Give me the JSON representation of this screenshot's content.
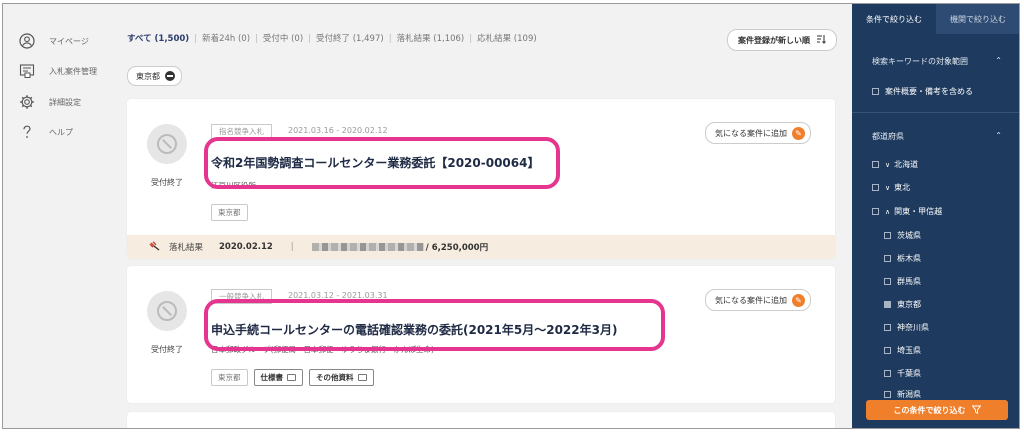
{
  "nav": {
    "items": [
      {
        "label": "マイページ",
        "icon": "user-circle-icon"
      },
      {
        "label": "入札案件管理",
        "icon": "document-list-icon"
      },
      {
        "label": "詳細設定",
        "icon": "gear-icon"
      },
      {
        "label": "ヘルプ",
        "icon": "question-icon"
      }
    ]
  },
  "filter_tabs": [
    {
      "label": "すべて (1,500)",
      "active": true
    },
    {
      "label": "新着24h (0)"
    },
    {
      "label": "受付中 (0)"
    },
    {
      "label": "受付終了 (1,497)"
    },
    {
      "label": "落札結果 (1,106)"
    },
    {
      "label": "応札結果 (109)"
    }
  ],
  "sort_button": "案件登録が新しい順",
  "region_chip": "東京都",
  "cards": [
    {
      "type_badge": "指名競争入札",
      "dates": "2021.03.16 - 2020.02.12",
      "title": "令和2年国勢調査コールセンター業務委託【2020-00064】",
      "org": "江戸川区役所",
      "status": "受付終了",
      "tags": [
        "東京都"
      ],
      "fav_label": "気になる案件に追加",
      "result": {
        "label": "落札結果",
        "date": "2020.02.12",
        "amount": "/ 6,250,000円"
      }
    },
    {
      "type_badge": "一般競争入札",
      "dates": "2021.03.12 - 2021.03.31",
      "title": "申込手続コールセンターの電話確認業務の委託(2021年5月～2022年3月)",
      "org": "日本郵政グループ(郵便局・日本郵便・ゆうちょ銀行・かんぽ生命)",
      "status": "受付終了",
      "tags": [
        "東京都"
      ],
      "doc_tags": [
        "仕様書",
        "その他資料"
      ],
      "fav_label": "気になる案件に追加"
    }
  ],
  "panel": {
    "tabs": [
      "条件で絞り込む",
      "機関で絞り込む"
    ],
    "keyword_section": "検索キーワードの対象範囲",
    "keyword_option": "案件概要・備考を含める",
    "pref_section": "都道府県",
    "regions": [
      {
        "label": "北海道",
        "chev": "∨"
      },
      {
        "label": "東北",
        "chev": "∨"
      },
      {
        "label": "関東・甲信越",
        "chev": "∧"
      }
    ],
    "prefs": [
      {
        "label": "茨城県",
        "checked": false
      },
      {
        "label": "栃木県",
        "checked": false
      },
      {
        "label": "群馬県",
        "checked": false
      },
      {
        "label": "東京都",
        "checked": true
      },
      {
        "label": "神奈川県",
        "checked": false
      },
      {
        "label": "埼玉県",
        "checked": false
      },
      {
        "label": "千葉県",
        "checked": false
      },
      {
        "label": "新潟県",
        "checked": false
      }
    ],
    "apply_button": "この条件で絞り込む"
  },
  "colors": {
    "accent_orange": "#f07f2c",
    "panel_navy": "#1e3a5f",
    "highlight_pink": "#e5358f"
  }
}
